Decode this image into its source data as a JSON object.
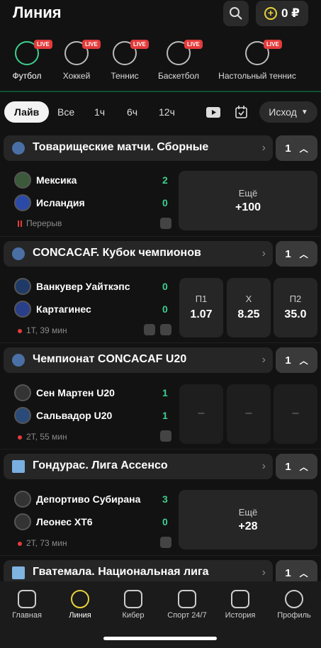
{
  "header": {
    "title": "Линия",
    "balance": "0 ₽"
  },
  "sports": [
    {
      "label": "Футбол",
      "live": "LIVE"
    },
    {
      "label": "Хоккей",
      "live": "LIVE"
    },
    {
      "label": "Теннис",
      "live": "LIVE"
    },
    {
      "label": "Баскетбол",
      "live": "LIVE"
    },
    {
      "label": "Настольный теннис",
      "live": "LIVE"
    }
  ],
  "filters": {
    "live": "Лайв",
    "all": "Все",
    "h1": "1ч",
    "h6": "6ч",
    "h12": "12ч",
    "sort": "Исход"
  },
  "sections": [
    {
      "title": "Товарищеские матчи. Сборные",
      "count": "1",
      "team1": "Мексика",
      "score1": "2",
      "team2": "Исландия",
      "score2": "0",
      "status": "Перерыв",
      "more_label": "Ещё",
      "more_value": "+100"
    },
    {
      "title": "CONCACAF. Кубок чемпионов",
      "count": "1",
      "team1": "Ванкувер Уайткэпс",
      "score1": "0",
      "team2": "Картагинес",
      "score2": "0",
      "status": "1Т, 39 мин",
      "odds": [
        {
          "k": "П1",
          "v": "1.07"
        },
        {
          "k": "Х",
          "v": "8.25"
        },
        {
          "k": "П2",
          "v": "35.0"
        }
      ]
    },
    {
      "title": "Чемпионат CONCACAF U20",
      "count": "1",
      "team1": "Сен Мартен U20",
      "score1": "1",
      "team2": "Сальвадор U20",
      "score2": "1",
      "status": "2Т, 55 мин",
      "empty": "–"
    },
    {
      "title": "Гондурас. Лига Ассенсо",
      "count": "1",
      "team1": "Депортиво Субирана",
      "score1": "3",
      "team2": "Леонес ХТ6",
      "score2": "0",
      "status": "2Т, 73 мин",
      "more_label": "Ещё",
      "more_value": "+28"
    },
    {
      "title": "Гватемала. Национальная лига",
      "count": "1"
    }
  ],
  "tabbar": [
    {
      "label": "Главная"
    },
    {
      "label": "Линия"
    },
    {
      "label": "Кибер"
    },
    {
      "label": "Спорт 24/7"
    },
    {
      "label": "История"
    },
    {
      "label": "Профиль"
    }
  ]
}
